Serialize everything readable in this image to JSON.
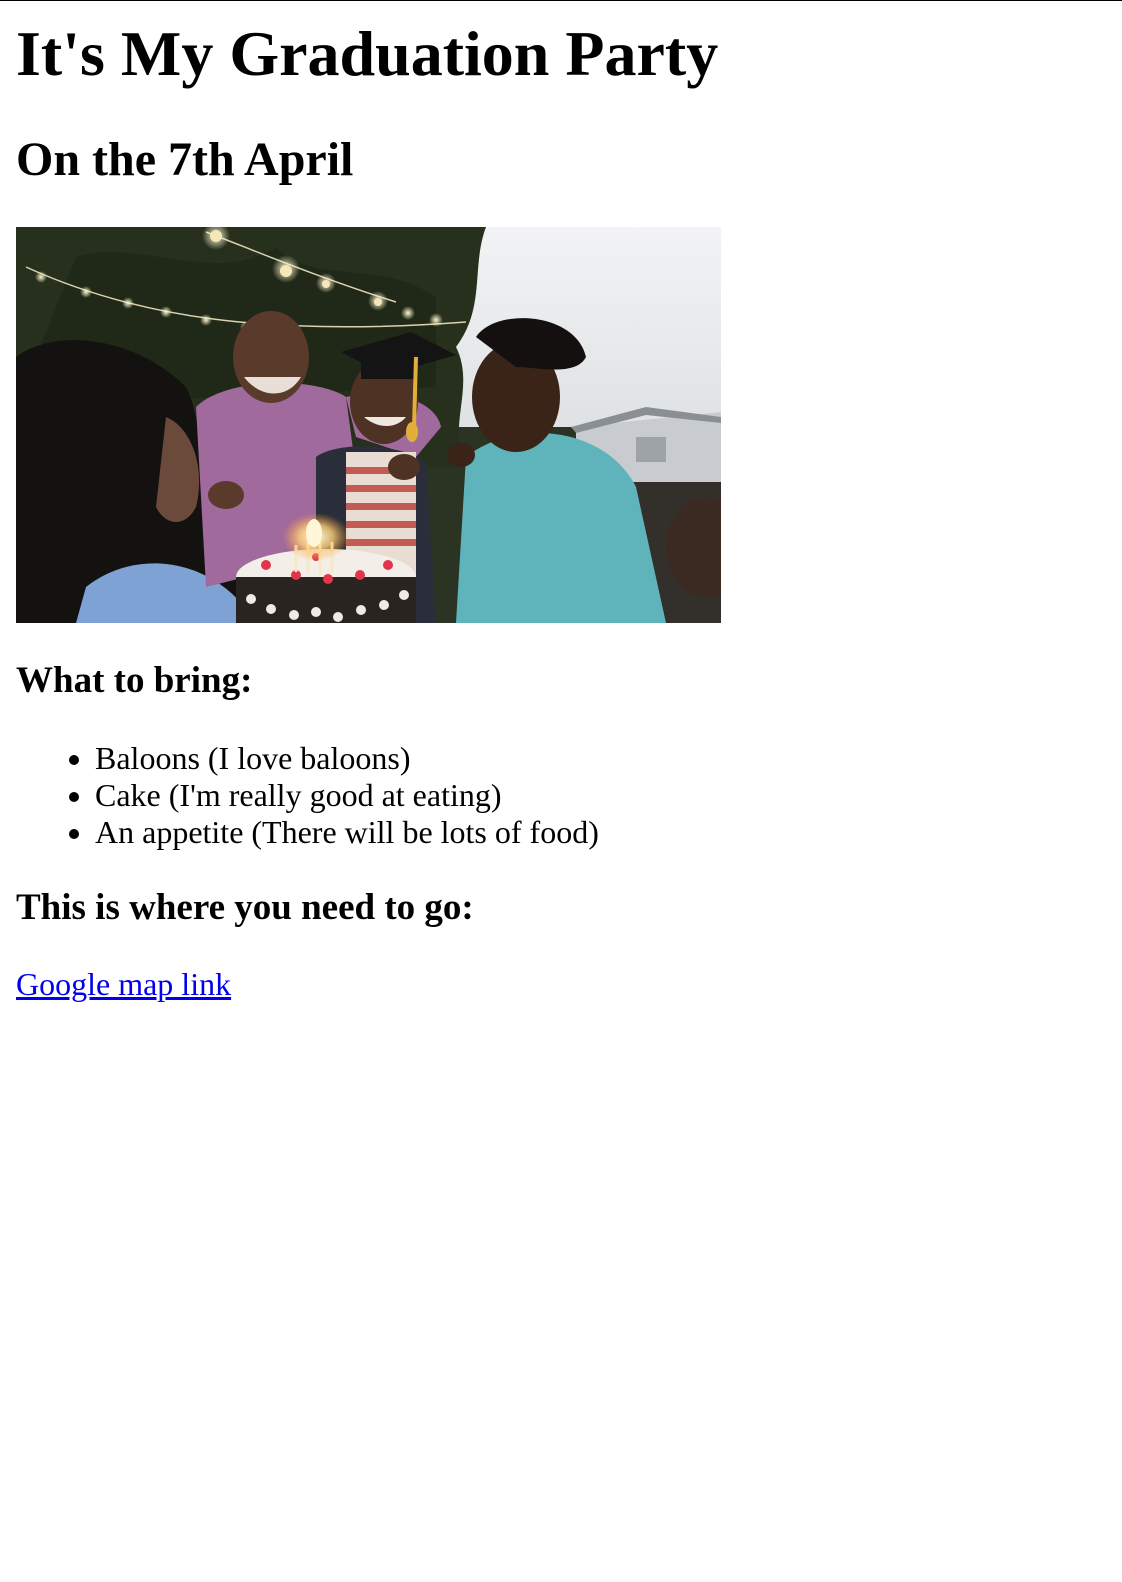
{
  "page": {
    "title": "It's My Graduation Party",
    "date_heading": "On the 7th April"
  },
  "photo": {
    "icon": "graduation-party-photo",
    "colors": {
      "foliage": "#2f3a24",
      "sky": "#e9ecee",
      "lights": "#f6e7b8",
      "cap": "#141414",
      "tassel": "#e2b03a",
      "cake_icing": "#f3efe8"
    }
  },
  "bring": {
    "heading": "What to bring:",
    "items": [
      "Baloons (I love baloons)",
      "Cake (I'm really good at eating)",
      "An appetite (There will be lots of food)"
    ]
  },
  "directions": {
    "heading": "This is where you need to go:",
    "link_text": "Google map link",
    "link_color": "#0000ee"
  }
}
